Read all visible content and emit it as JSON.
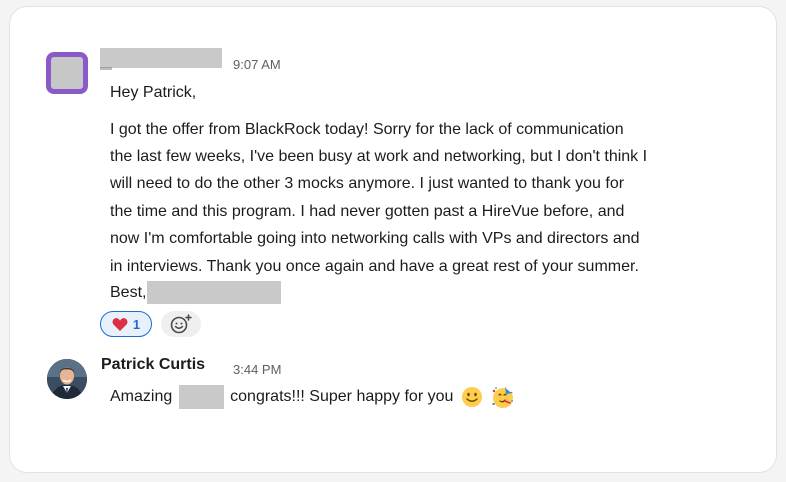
{
  "first_message": {
    "timestamp": "9:07 AM",
    "lines": [
      "Hey Patrick,",
      "I got the offer from BlackRock today! Sorry for the lack of communication",
      "the last few weeks, I've been busy at work and networking, but I don't think I",
      "will need to do the other 3 mocks anymore. I just wanted to thank you for",
      "the time and this program. I had never gotten past a HireVue before, and",
      "now I'm comfortable going into networking calls with VPs and directors and",
      "in interviews. Thank you once again and have a great rest of your summer."
    ],
    "signoff": "Best,",
    "reaction": {
      "emoji": "heart",
      "count": "1"
    }
  },
  "second_message": {
    "author": "Patrick Curtis",
    "timestamp": "3:44 PM",
    "text_before": "Amazing",
    "text_after": "congrats!!! Super happy for you",
    "emojis": [
      "slightly-smiling-face",
      "partying-face"
    ]
  },
  "colors": {
    "avatar_border": "#8a5ac9",
    "reaction_border": "#1d6bd3",
    "redaction": "#c9c9c9"
  }
}
